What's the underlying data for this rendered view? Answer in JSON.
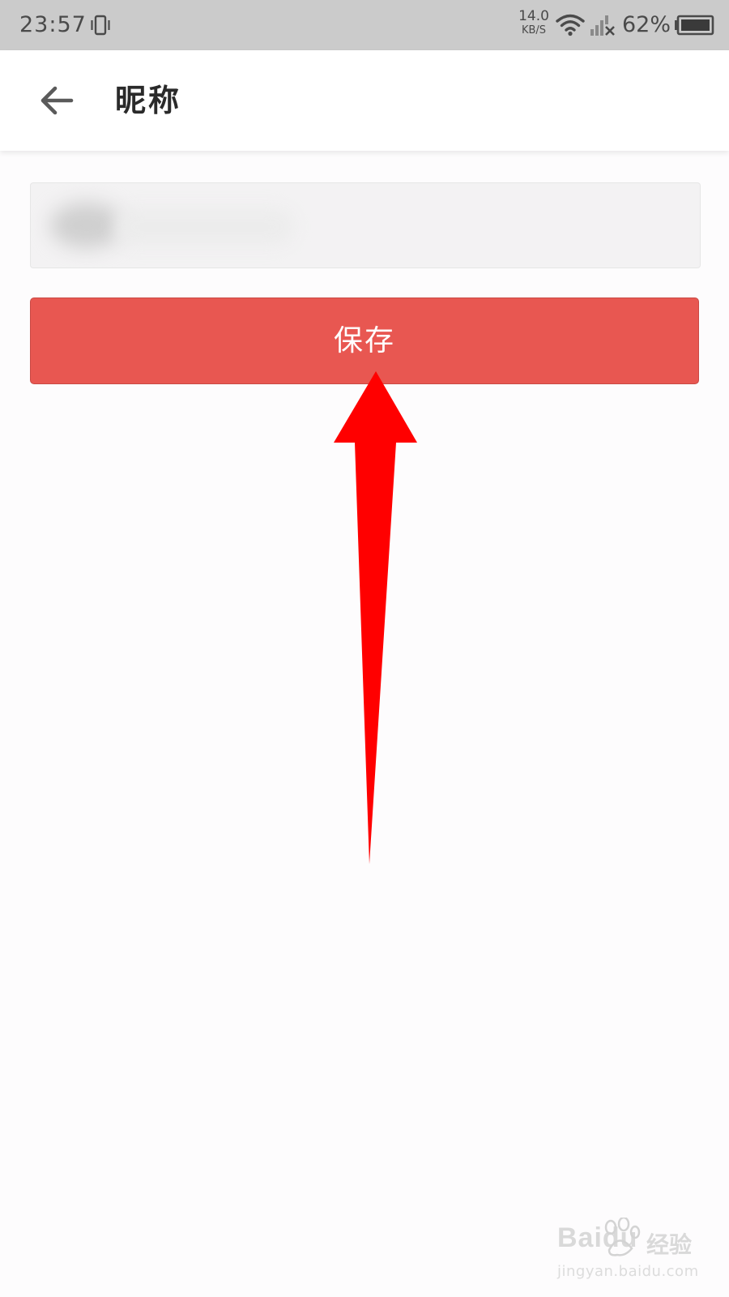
{
  "status_bar": {
    "time": "23:57",
    "net_speed_value": "14.0",
    "net_speed_unit": "KB/S",
    "battery_percent": "62%",
    "battery_level": 0.62
  },
  "app_bar": {
    "title": "昵称",
    "back_icon": "back-arrow-icon"
  },
  "nickname_input": {
    "value": "",
    "content_obscured": true
  },
  "actions": {
    "save_label": "保存"
  },
  "annotation": {
    "arrow_color": "#ff0000",
    "points_to": "save-button"
  },
  "watermark": {
    "logo_text": "Baidu",
    "logo_cn": "经验",
    "url": "jingyan.baidu.com"
  },
  "colors": {
    "status_bar_bg": "#cbcbcb",
    "app_bar_bg": "#ffffff",
    "page_bg": "#fdfcfd",
    "input_bg": "#f3f2f3",
    "save_button_bg": "#e85751",
    "save_button_text": "#ffffff"
  }
}
